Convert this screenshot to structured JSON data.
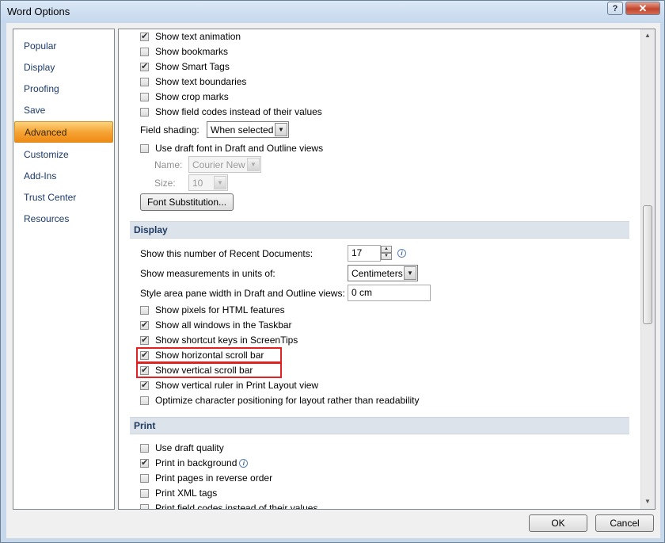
{
  "window": {
    "title": "Word Options",
    "help_glyph": "?",
    "close_glyph": "✕"
  },
  "nav": {
    "items": [
      {
        "label": "Popular",
        "selected": false
      },
      {
        "label": "Display",
        "selected": false
      },
      {
        "label": "Proofing",
        "selected": false
      },
      {
        "label": "Save",
        "selected": false
      },
      {
        "label": "Advanced",
        "selected": true
      },
      {
        "label": "Customize",
        "selected": false
      },
      {
        "label": "Add-Ins",
        "selected": false
      },
      {
        "label": "Trust Center",
        "selected": false
      },
      {
        "label": "Resources",
        "selected": false
      }
    ]
  },
  "show_content": {
    "text_animation": {
      "label": "Show text animation",
      "checked": true
    },
    "bookmarks": {
      "label": "Show bookmarks",
      "checked": false
    },
    "smart_tags": {
      "label": "Show Smart Tags",
      "checked": true
    },
    "text_boundaries": {
      "label": "Show text boundaries",
      "checked": false
    },
    "crop_marks": {
      "label": "Show crop marks",
      "checked": false
    },
    "field_codes": {
      "label": "Show field codes instead of their values",
      "checked": false
    },
    "field_shading_label": "Field shading:",
    "field_shading_value": "When selected",
    "draft_font": {
      "label": "Use draft font in Draft and Outline views",
      "checked": false
    },
    "name_label": "Name:",
    "name_value": "Courier New",
    "size_label": "Size:",
    "size_value": "10",
    "font_substitution_label": "Font Substitution..."
  },
  "display": {
    "header": "Display",
    "recent_docs_label": "Show this number of Recent Documents:",
    "recent_docs_value": "17",
    "measurements_label": "Show measurements in units of:",
    "measurements_value": "Centimeters",
    "style_area_label": "Style area pane width in Draft and Outline views:",
    "style_area_value": "0 cm",
    "pixels_html": {
      "label": "Show pixels for HTML features",
      "checked": false
    },
    "all_windows": {
      "label": "Show all windows in the Taskbar",
      "checked": true
    },
    "shortcut_keys": {
      "label": "Show shortcut keys in ScreenTips",
      "checked": true
    },
    "horizontal_scroll": {
      "label": "Show horizontal scroll bar",
      "checked": true
    },
    "vertical_scroll": {
      "label": "Show vertical scroll bar",
      "checked": true
    },
    "vertical_ruler": {
      "label": "Show vertical ruler in Print Layout view",
      "checked": true
    },
    "optimize_char": {
      "label": "Optimize character positioning for layout rather than readability",
      "checked": false
    }
  },
  "print": {
    "header": "Print",
    "draft_quality": {
      "label": "Use draft quality",
      "checked": false
    },
    "background": {
      "label": "Print in background",
      "checked": true
    },
    "reverse_order": {
      "label": "Print pages in reverse order",
      "checked": false
    },
    "xml_tags": {
      "label": "Print XML tags",
      "checked": false
    },
    "field_codes": {
      "label": "Print field codes instead of their values",
      "checked": false
    }
  },
  "buttons": {
    "ok": "OK",
    "cancel": "Cancel"
  },
  "colors": {
    "selected_nav": "#f5a436",
    "highlight_box": "#e02222",
    "section_header_bg": "#dde3ea"
  }
}
